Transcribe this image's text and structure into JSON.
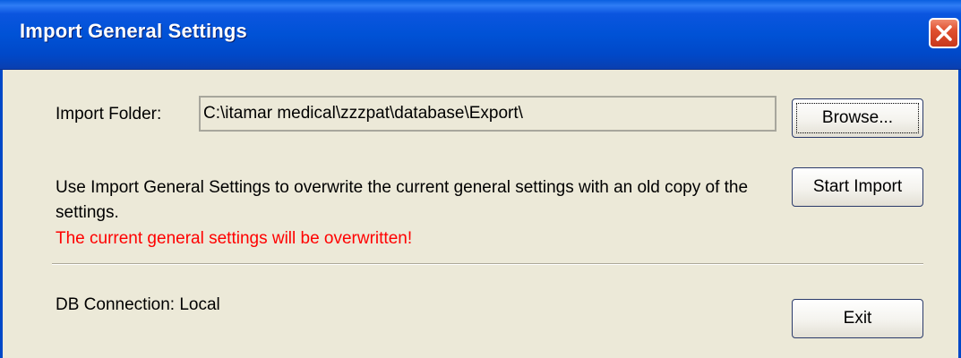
{
  "window": {
    "title": "Import General Settings"
  },
  "import_folder": {
    "label": "Import Folder:",
    "value": "C:\\itamar medical\\zzzpat\\database\\Export\\"
  },
  "buttons": {
    "browse_label": "Browse...",
    "start_import_label": "Start Import",
    "exit_label": "Exit"
  },
  "description": "Use Import General Settings to overwrite the current general settings with an old copy of the settings.",
  "warning": "The current general settings will be overwritten!",
  "db_connection": "DB Connection: Local",
  "colors": {
    "titlebar": "#0052d6",
    "background": "#ece9d8",
    "warning": "#ff0000",
    "close_button": "#e0502f"
  },
  "icons": {
    "close": "close-icon"
  }
}
